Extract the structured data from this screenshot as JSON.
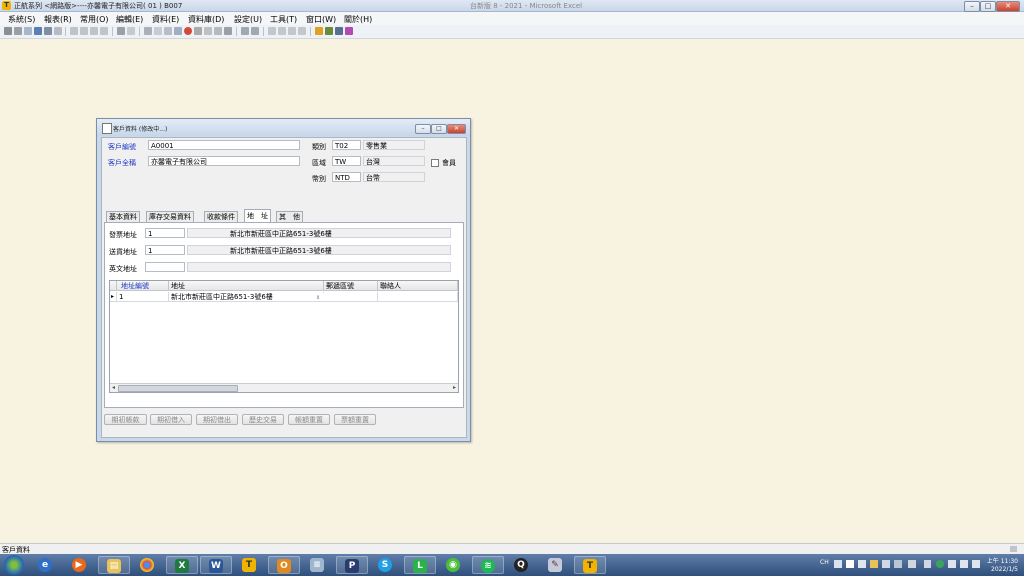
{
  "window": {
    "title": "正航系列 <網路版>----亦馨電子有限公司( 01 ) B007",
    "faded_title_right": "台新版 8 - 2021 - Microsoft Excel"
  },
  "menu": [
    "系統(S)",
    "報表(R)",
    "常用(O)",
    "編輯(E)",
    "資料(E)",
    "資料庫(D)",
    "設定(U)",
    "工具(T)",
    "窗口(W)",
    "關於(H)"
  ],
  "dialog": {
    "title": "客戶資料 (修改中...)",
    "fields": {
      "customer_code_label": "客戶編號",
      "customer_code": "A0001",
      "customer_name_label": "客戶全稱",
      "customer_name": "亦馨電子有限公司",
      "category_label": "類別",
      "category_code": "T02",
      "category_name": "零售業",
      "region_label": "區域",
      "region_code": "TW",
      "region_name": "台灣",
      "currency_label": "幣別",
      "currency_code": "NTD",
      "currency_name": "台幣",
      "member_label": "會員"
    },
    "tabs": [
      "基本資料",
      "庫存交易資料",
      "收款條件",
      "地　址",
      "其　他"
    ],
    "active_tab": "地　址",
    "address": {
      "invoice_label": "發票地址",
      "invoice_no": "1",
      "invoice_addr": "新北市新莊區中正路651-3號6樓",
      "delivery_label": "送貨地址",
      "delivery_no": "1",
      "delivery_addr": "新北市新莊區中正路651-3號6樓",
      "english_label": "英文地址",
      "english_no": "",
      "english_addr": ""
    },
    "grid": {
      "headers": [
        "地址編號",
        "地址",
        "郵遞區號",
        "聯絡人"
      ],
      "rows": [
        {
          "no": "1",
          "addr": "新北市新莊區中正路651-3號6樓",
          "zip": "",
          "contact": ""
        }
      ]
    },
    "buttons": [
      "期初帳款",
      "期初借入",
      "期初借出",
      "歷史交易",
      "帳額重置",
      "票額重置"
    ]
  },
  "status": {
    "text": "客戶資料"
  },
  "clock": {
    "time": "上午 11:30",
    "date": "2022/1/5"
  },
  "tray": {
    "lang": "CH"
  },
  "taskbar_apps": [
    "ie",
    "media-player",
    "explorer",
    "chrome",
    "excel",
    "word",
    "chinghwa",
    "outlook",
    "scanner",
    "powerpoint",
    "skype",
    "line",
    "wechat",
    "spotify",
    "qq",
    "tool",
    "chinghwa-active"
  ]
}
